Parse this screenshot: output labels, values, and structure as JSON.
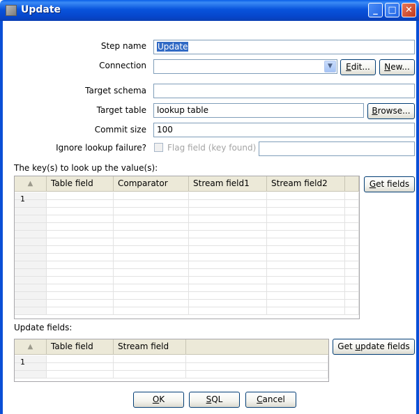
{
  "window": {
    "title": "Update",
    "minimize_glyph": "_",
    "maximize_glyph": "□",
    "close_glyph": "✕"
  },
  "form": {
    "step_name_label": "Step name",
    "step_name_value": "Update",
    "connection_label": "Connection",
    "connection_value": "",
    "edit_button": {
      "mnemonic": "E",
      "rest": "dit..."
    },
    "new_button": {
      "mnemonic": "N",
      "rest": "ew..."
    },
    "target_schema_label": "Target schema",
    "target_schema_value": "",
    "target_table_label": "Target table",
    "target_table_value": "lookup table",
    "browse_button": {
      "mnemonic": "B",
      "rest": "rowse..."
    },
    "commit_size_label": "Commit size",
    "commit_size_value": "100",
    "ignore_failure_label": "Ignore lookup failure?",
    "flag_field_label": "Flag field (key found)",
    "flag_field_value": ""
  },
  "keys_section": {
    "label": "The key(s) to look up the value(s):",
    "columns": [
      "▲",
      "Table field",
      "Comparator",
      "Stream field1",
      "Stream field2"
    ],
    "rows": [
      [
        "1",
        "",
        "",
        "",
        ""
      ]
    ],
    "get_fields_button": {
      "mnemonic": "G",
      "rest": "et fields"
    }
  },
  "update_section": {
    "label": "Update fields:",
    "columns": [
      "▲",
      "Table field",
      "Stream field"
    ],
    "rows": [
      [
        "1",
        "",
        ""
      ]
    ],
    "get_update_fields_button": {
      "before": "Get ",
      "mnemonic": "u",
      "rest": "pdate fields"
    }
  },
  "footer": {
    "ok_button": {
      "mnemonic": "O",
      "rest": "K"
    },
    "sql_button": {
      "mnemonic": "S",
      "rest": "QL"
    },
    "cancel_button": {
      "mnemonic": "C",
      "rest": "ancel"
    }
  },
  "colors": {
    "titlebar": "#0853dc",
    "selection": "#316ac5",
    "button_border": "#003c74"
  }
}
